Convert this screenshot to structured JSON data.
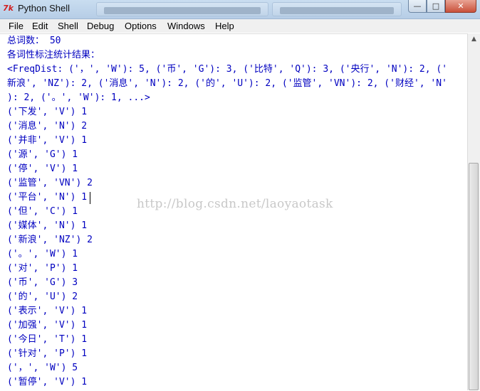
{
  "window": {
    "icon_label": "7k",
    "title": "Python Shell",
    "min_glyph": "—",
    "max_glyph": "□",
    "close_glyph": "✕"
  },
  "menu": [
    "File",
    "Edit",
    "Shell",
    "Debug",
    "Options",
    "Windows",
    "Help"
  ],
  "shell": {
    "lines": [
      {
        "text": "总词数： 50",
        "color": "#0000c0"
      },
      {
        "text": "各词性标注统计结果：",
        "color": "#0000c0"
      },
      {
        "text": "<FreqDist: ('，', 'W'): 5, ('币', 'G'): 3, ('比特', 'Q'): 3, ('央行', 'N'): 2, ('",
        "color": "#0000c0"
      },
      {
        "text": "新浪', 'NZ'): 2, ('消息', 'N'): 2, ('的', 'U'): 2, ('监管', 'VN'): 2, ('财经', 'N'",
        "color": "#0000c0"
      },
      {
        "text": "): 2, ('。', 'W'): 1, ...>",
        "color": "#0000c0"
      },
      {
        "text": "('下发', 'V') 1",
        "color": "#0000c0"
      },
      {
        "text": "('消息', 'N') 2",
        "color": "#0000c0"
      },
      {
        "text": "('并非', 'V') 1",
        "color": "#0000c0"
      },
      {
        "text": "('源', 'G') 1",
        "color": "#0000c0"
      },
      {
        "text": "('停', 'V') 1",
        "color": "#0000c0"
      },
      {
        "text": "('监管', 'VN') 2",
        "color": "#0000c0"
      },
      {
        "text": "('平台', 'N') 1",
        "color": "#0000c0"
      },
      {
        "text": "('但', 'C') 1",
        "color": "#0000c0"
      },
      {
        "text": "('媒体', 'N') 1",
        "color": "#0000c0"
      },
      {
        "text": "('新浪', 'NZ') 2",
        "color": "#0000c0"
      },
      {
        "text": "('。', 'W') 1",
        "color": "#0000c0"
      },
      {
        "text": "('对', 'P') 1",
        "color": "#0000c0"
      },
      {
        "text": "('币', 'G') 3",
        "color": "#0000c0"
      },
      {
        "text": "('的', 'U') 2",
        "color": "#0000c0"
      },
      {
        "text": "('表示', 'V') 1",
        "color": "#0000c0"
      },
      {
        "text": "('加强', 'V') 1",
        "color": "#0000c0"
      },
      {
        "text": "('今日', 'T') 1",
        "color": "#0000c0"
      },
      {
        "text": "('针对', 'P') 1",
        "color": "#0000c0"
      },
      {
        "text": "('，', 'W') 5",
        "color": "#0000c0"
      },
      {
        "text": "('暂停', 'V') 1",
        "color": "#0000c0"
      }
    ]
  },
  "watermark": "http://blog.csdn.net/laoyaotask",
  "scrollbar": {
    "up_glyph": "▲",
    "thumb_position": 0.36
  }
}
